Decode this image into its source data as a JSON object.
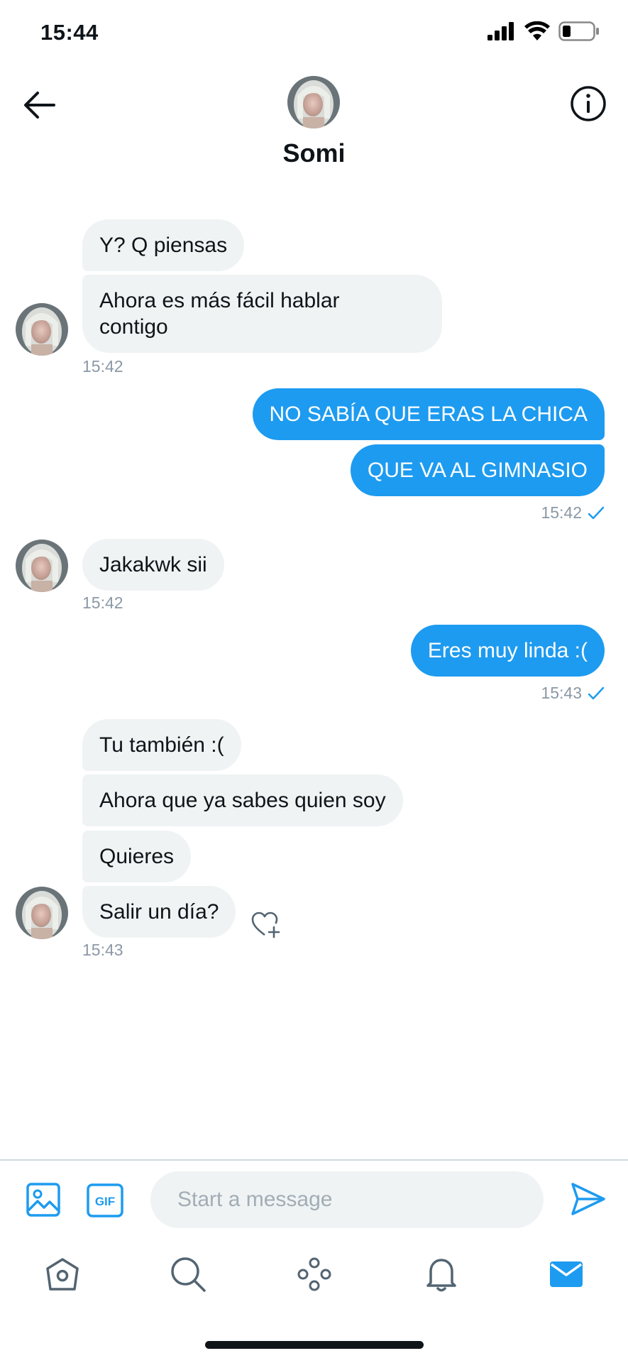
{
  "status_bar": {
    "time": "15:44"
  },
  "header": {
    "name": "Somi"
  },
  "composer": {
    "placeholder": "Start a message",
    "gif_label": "GIF"
  },
  "colors": {
    "accent": "#1d9bf0",
    "incoming_bubble": "#eff3f4",
    "timestamp": "#8b98a5"
  },
  "messages": [
    {
      "direction": "in",
      "text": "Y? Q piensas"
    },
    {
      "direction": "in",
      "text": "Ahora es más fácil hablar",
      "text_line2": "contigo",
      "time": "15:42"
    },
    {
      "direction": "out",
      "text": "NO SABÍA QUE ERAS LA CHICA"
    },
    {
      "direction": "out",
      "text": "QUE VA AL GIMNASIO",
      "time": "15:42",
      "read": true
    },
    {
      "direction": "in",
      "text": "Jakakwk sii",
      "time": "15:42"
    },
    {
      "direction": "out",
      "text": "Eres muy linda :(",
      "time": "15:43",
      "read": true
    },
    {
      "direction": "in",
      "text": "Tu también :("
    },
    {
      "direction": "in",
      "text": "Ahora que ya sabes quien soy"
    },
    {
      "direction": "in",
      "text": "Quieres"
    },
    {
      "direction": "in",
      "text": "Salir un día?",
      "time": "15:43"
    }
  ],
  "icons": {
    "back": "arrow-left-icon",
    "info": "info-icon",
    "media": "image-icon",
    "gif": "gif-icon",
    "send": "send-icon",
    "react": "heart-plus-icon",
    "read_receipt": "checkmark-icon",
    "tabs": [
      "home-icon",
      "search-icon",
      "communities-icon",
      "bell-icon",
      "mail-icon"
    ]
  }
}
